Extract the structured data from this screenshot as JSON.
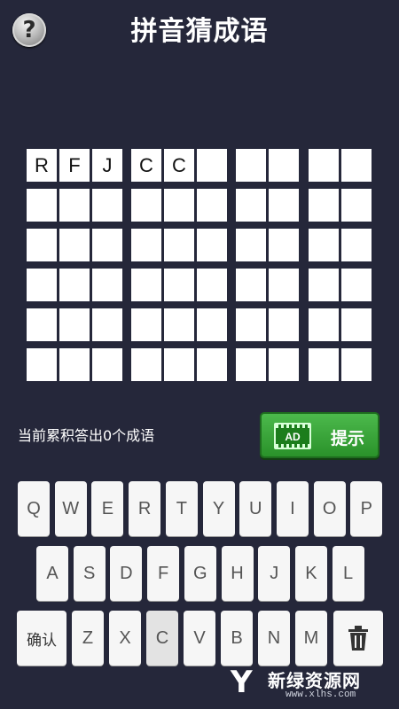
{
  "header": {
    "help_icon_label": "?",
    "title": "拼音猜成语"
  },
  "board": {
    "row_letters": [
      "R",
      "F",
      "J",
      "C",
      "C",
      "",
      "",
      "",
      "",
      ""
    ]
  },
  "status": {
    "score_text": "当前累积答出0个成语"
  },
  "hint": {
    "ad_label": "AD",
    "label": "提示"
  },
  "keyboard": {
    "row1": [
      "Q",
      "W",
      "E",
      "R",
      "T",
      "Y",
      "U",
      "I",
      "O",
      "P"
    ],
    "row2": [
      "A",
      "S",
      "D",
      "F",
      "G",
      "H",
      "J",
      "K",
      "L"
    ],
    "row3": [
      "Z",
      "X",
      "C",
      "V",
      "B",
      "N",
      "M"
    ],
    "confirm_label": "确认"
  },
  "watermark": {
    "logo": "Y",
    "title": "新绿资源网",
    "sub": "www.xlhs.com"
  },
  "colors": {
    "background": "#25273a",
    "hint_green": "#3aa53a",
    "key": "#f6f6f6"
  }
}
